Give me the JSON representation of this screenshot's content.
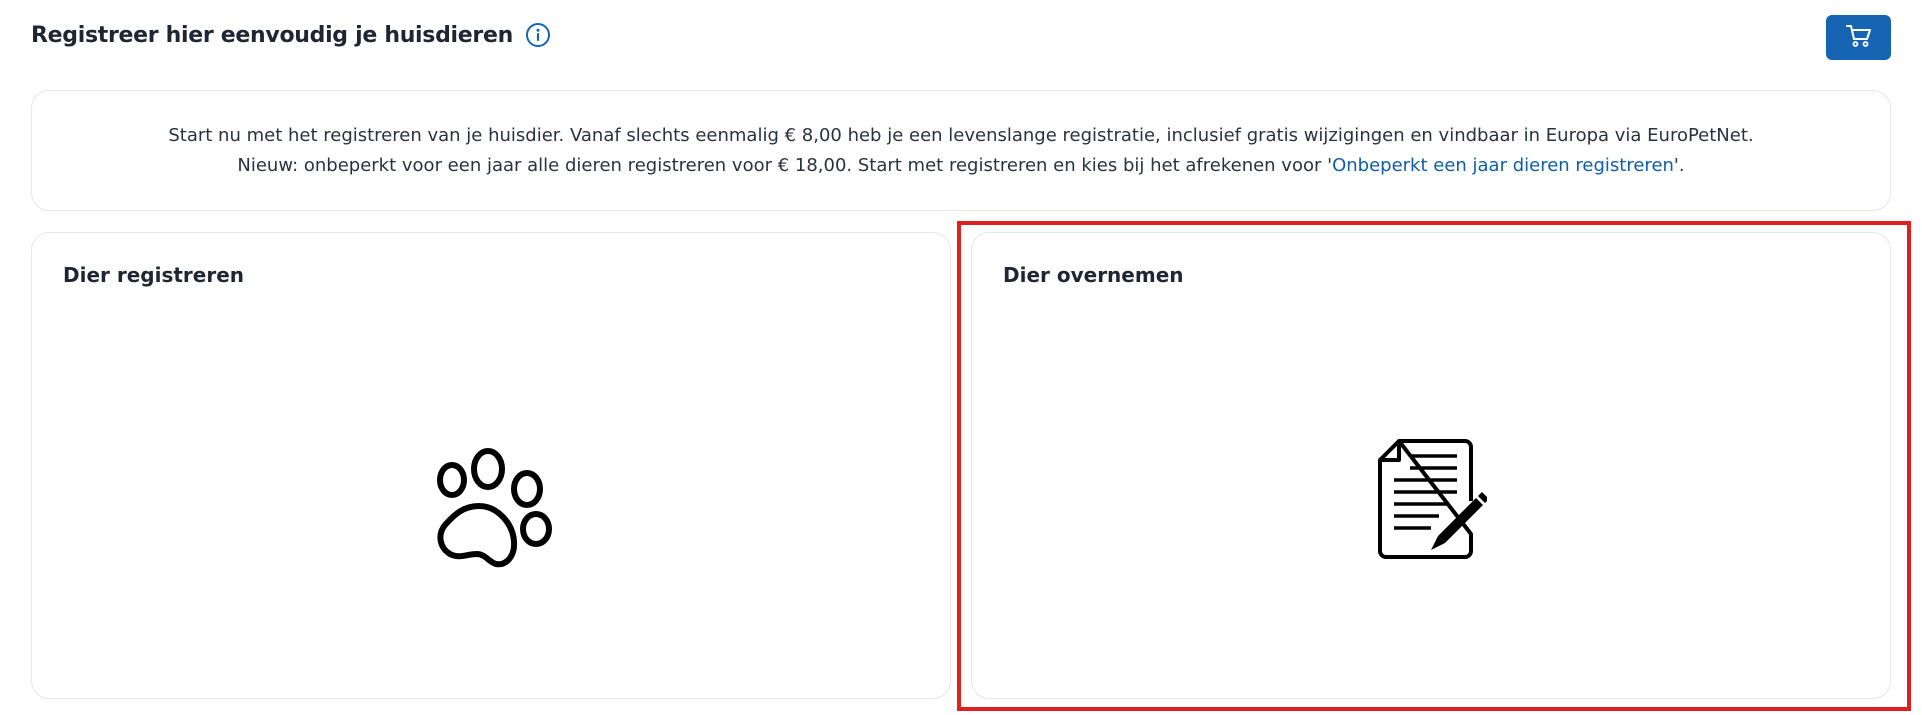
{
  "header": {
    "title": "Registreer hier eenvoudig je huisdieren",
    "info_icon": "info-circle-icon"
  },
  "cart": {
    "icon": "shopping-cart-icon",
    "color": "#1565b3"
  },
  "info": {
    "line1": "Start nu met het registreren van je huisdier. Vanaf slechts eenmalig € 8,00 heb je een levenslange registratie, inclusief gratis wijzigingen en vindbaar in Europa via EuroPetNet.",
    "line2_prefix": "Nieuw: onbeperkt voor een jaar alle dieren registreren voor € 18,00. Start met registreren en kies bij het afrekenen voor '",
    "line2_link": "Onbeperkt een jaar dieren registreren",
    "line2_suffix": "'."
  },
  "cards": [
    {
      "title": "Dier registreren",
      "icon": "paw-icon"
    },
    {
      "title": "Dier overnemen",
      "icon": "document-pencil-icon"
    }
  ],
  "colors": {
    "accent": "#1565b3",
    "link": "#0f5ea8",
    "highlight": "#e02020"
  }
}
